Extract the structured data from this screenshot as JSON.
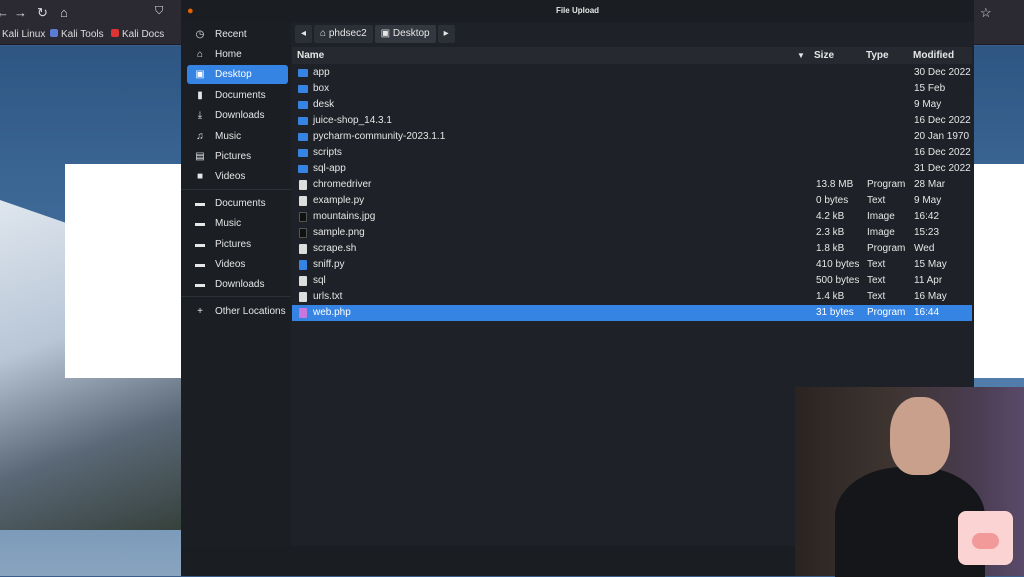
{
  "browser": {
    "bookmarks": [
      "Kali Linux",
      "Kali Tools",
      "Kali Docs"
    ]
  },
  "dialog": {
    "title": "File Upload",
    "sidebar": [
      {
        "label": "Recent",
        "icon": "clock-icon",
        "glyph": "◷"
      },
      {
        "label": "Home",
        "icon": "home-icon",
        "glyph": "⌂"
      },
      {
        "label": "Desktop",
        "icon": "desktop-icon",
        "glyph": "▣",
        "selected": true
      },
      {
        "label": "Documents",
        "icon": "document-icon",
        "glyph": "▮"
      },
      {
        "label": "Downloads",
        "icon": "download-icon",
        "glyph": "⤓"
      },
      {
        "label": "Music",
        "icon": "music-icon",
        "glyph": "♫"
      },
      {
        "label": "Pictures",
        "icon": "picture-icon",
        "glyph": "▤"
      },
      {
        "label": "Videos",
        "icon": "video-icon",
        "glyph": "■"
      },
      {
        "label": "Documents",
        "icon": "folder-icon",
        "glyph": "▬"
      },
      {
        "label": "Music",
        "icon": "folder-icon",
        "glyph": "▬"
      },
      {
        "label": "Pictures",
        "icon": "folder-icon",
        "glyph": "▬"
      },
      {
        "label": "Videos",
        "icon": "folder-icon",
        "glyph": "▬"
      },
      {
        "label": "Downloads",
        "icon": "folder-icon",
        "glyph": "▬"
      },
      {
        "label": "Other Locations",
        "icon": "plus-icon",
        "glyph": "+"
      }
    ],
    "path": [
      "phdsec2",
      "Desktop"
    ],
    "columns": {
      "name": "Name",
      "size": "Size",
      "type": "Type",
      "modified": "Modified"
    },
    "files": [
      {
        "name": "app",
        "size": "",
        "type": "",
        "modified": "30 Dec 2022",
        "kind": "folder"
      },
      {
        "name": "box",
        "size": "",
        "type": "",
        "modified": "15 Feb",
        "kind": "folder"
      },
      {
        "name": "desk",
        "size": "",
        "type": "",
        "modified": "9 May",
        "kind": "folder"
      },
      {
        "name": "juice-shop_14.3.1",
        "size": "",
        "type": "",
        "modified": "16 Dec 2022",
        "kind": "folder"
      },
      {
        "name": "pycharm-community-2023.1.1",
        "size": "",
        "type": "",
        "modified": "20 Jan 1970",
        "kind": "folder"
      },
      {
        "name": "scripts",
        "size": "",
        "type": "",
        "modified": "16 Dec 2022",
        "kind": "folder"
      },
      {
        "name": "sql-app",
        "size": "",
        "type": "",
        "modified": "31 Dec 2022",
        "kind": "folder"
      },
      {
        "name": "chromedriver",
        "size": "13.8 MB",
        "type": "Program",
        "modified": "28 Mar",
        "kind": "program"
      },
      {
        "name": "example.py",
        "size": "0 bytes",
        "type": "Text",
        "modified": "9 May",
        "kind": "text"
      },
      {
        "name": "mountains.jpg",
        "size": "4.2 kB",
        "type": "Image",
        "modified": "16:42",
        "kind": "image"
      },
      {
        "name": "sample.png",
        "size": "2.3 kB",
        "type": "Image",
        "modified": "15:23",
        "kind": "image"
      },
      {
        "name": "scrape.sh",
        "size": "1.8 kB",
        "type": "Program",
        "modified": "Wed",
        "kind": "text"
      },
      {
        "name": "sniff.py",
        "size": "410 bytes",
        "type": "Text",
        "modified": "15 May",
        "kind": "python"
      },
      {
        "name": "sql",
        "size": "500 bytes",
        "type": "Text",
        "modified": "11 Apr",
        "kind": "text"
      },
      {
        "name": "urls.txt",
        "size": "1.4 kB",
        "type": "Text",
        "modified": "16 May",
        "kind": "text"
      },
      {
        "name": "web.php",
        "size": "31 bytes",
        "type": "Program",
        "modified": "16:44",
        "kind": "php",
        "selected": true
      }
    ]
  },
  "colors": {
    "accent": "#3584e4",
    "folder": "#3584e4",
    "dialog_bg": "#1e2127"
  }
}
